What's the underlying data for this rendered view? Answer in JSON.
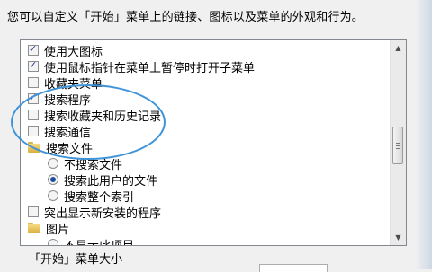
{
  "description": "您可以自定义「开始」菜单上的链接、图标以及菜单的外观和行为。",
  "list": {
    "items": [
      {
        "type": "checkbox",
        "checked": true,
        "label": "使用大图标"
      },
      {
        "type": "checkbox",
        "checked": true,
        "label": "使用鼠标指针在菜单上暂停时打开子菜单"
      },
      {
        "type": "checkbox",
        "checked": false,
        "label": "收藏夹菜单"
      },
      {
        "type": "checkbox",
        "checked": true,
        "label": "搜索程序"
      },
      {
        "type": "checkbox",
        "checked": false,
        "label": "搜索收藏夹和历史记录"
      },
      {
        "type": "checkbox",
        "checked": false,
        "label": "搜索通信"
      },
      {
        "type": "folder",
        "label": "搜索文件"
      },
      {
        "type": "radio",
        "checked": false,
        "label": "不搜索文件",
        "indent": true
      },
      {
        "type": "radio",
        "checked": true,
        "label": "搜索此用户的文件",
        "indent": true
      },
      {
        "type": "radio",
        "checked": false,
        "label": "搜索整个索引",
        "indent": true
      },
      {
        "type": "checkbox",
        "checked": false,
        "label": "突出显示新安装的程序"
      },
      {
        "type": "folder",
        "label": "图片"
      },
      {
        "type": "radio",
        "checked": false,
        "label": "不显示此项目",
        "indent": true
      }
    ]
  },
  "size_group": {
    "title": "「开始」菜单大小"
  },
  "colors": {
    "accent": "#3f93d8"
  }
}
